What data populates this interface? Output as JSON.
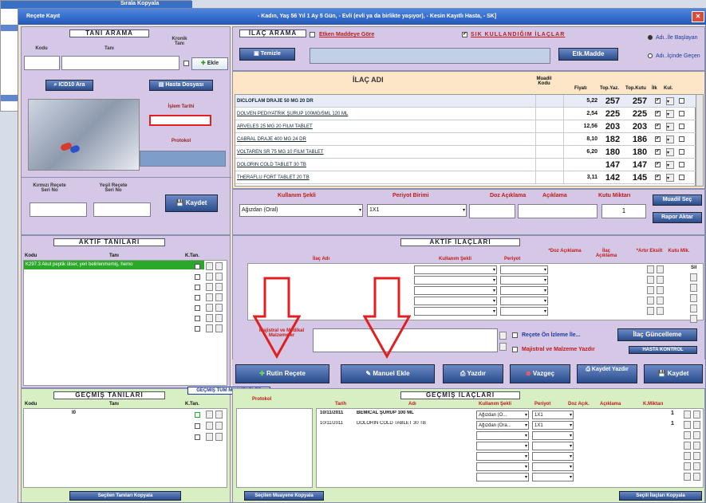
{
  "background_window": {
    "label": "Sırala Kopyala"
  },
  "window": {
    "title": "Reçete Kayıt",
    "patient_info": "- Kadın, Yaş 56 Yıl 1 Ay 5 Gün, - Evli (evli ya da birlikte yaşıyor), - Kesin Kayıtlı Hasta, - SK]"
  },
  "tani_arama": {
    "heading": "TANI ARAMA",
    "kodu_label": "Kodu",
    "tani_label": "Tanı",
    "kronik_label": "Kronik Tanı",
    "ekle_label": "Ekle",
    "icd10_label": "ICD10 Ara",
    "hasta_dosyasi_label": "Hasta Dosyası",
    "islem_tarihi_label": "İşlem Tarihi",
    "protokol_label": "Protokol"
  },
  "recete_seri": {
    "kirmizi_label": "Kırmızı Reçete Seri No",
    "yesil_label": "Yeşil Reçete Seri No",
    "kaydet_label": "Kaydet"
  },
  "ilac_arama": {
    "heading": "İLAÇ ARAMA",
    "etken_madde_label": "Etken Maddeye Göre",
    "sik_kullandigim_label": "SIK KULLANDIĞIM İLAÇLAR",
    "ad_ile_baslayan": "Adı..İle Başlayan",
    "ad_icinde_gecen": "Adı..İçinde Geçen",
    "temizle_label": "Temizle",
    "etk_madde_label": "Etk.Madde"
  },
  "ilac_table": {
    "headers": {
      "ilac_adi": "İLAÇ ADI",
      "muadil": "Muadil Kodu",
      "fiyat": "Fiyatı",
      "top_yaz": "Top.Yaz.",
      "top_kutu": "Top.Kutu",
      "ilk": "İlk",
      "kul": "Kul."
    },
    "rows": [
      {
        "name": "DICLOFLAM DRAJE 50 MG 20 DR",
        "price": "5,22",
        "top_yaz": "257",
        "top_kutu": "257"
      },
      {
        "name": "DOLVEN PEDIYATRIK ŞURUP 100MG/5ML 120 ML",
        "price": "2,54",
        "top_yaz": "225",
        "top_kutu": "225"
      },
      {
        "name": "ARVELES 25 MG 20 FILM TABLET",
        "price": "12,56",
        "top_yaz": "203",
        "top_kutu": "203"
      },
      {
        "name": "CABRAL DRAJE 400 MG 24 DR",
        "price": "8,10",
        "top_yaz": "182",
        "top_kutu": "186"
      },
      {
        "name": "VOLTAREN SR 75 MG 10 FILM TABLET",
        "price": "6,20",
        "top_yaz": "180",
        "top_kutu": "180"
      },
      {
        "name": "DOLORIN COLD TABLET 30 TB",
        "price": "",
        "top_yaz": "147",
        "top_kutu": "147"
      },
      {
        "name": "THERAFLU FORT TABLET 20 TB",
        "price": "3,11",
        "top_yaz": "142",
        "top_kutu": "145"
      }
    ]
  },
  "kullanim": {
    "kullanim_sekli_label": "Kullanım Şekli",
    "periyot_birimi_label": "Periyot Birimi",
    "doz_aciklama_label": "Doz Açıklama",
    "aciklama_label": "Açıklama",
    "kutu_miktari_label": "Kutu Miktarı",
    "kullanim_value": "Ağızdan (Oral)",
    "periyot_value": "1X1",
    "kutu_value": "1",
    "muadil_sec_label": "Muadil Seç",
    "rapor_aktar_label": "Rapor Aktar"
  },
  "aktif_tanilari": {
    "heading": "AKTİF TANILARI",
    "kodu_label": "Kodu",
    "tani_label": "Tanı",
    "ktan_label": "K.Tan.",
    "row_text": "K297.3  Akut peptik ülser, yeri belirlenmemiş, hemo"
  },
  "aktif_ilaclari": {
    "heading": "AKTİF İLAÇLARI",
    "ilac_adi_label": "İlaç Adı",
    "kullanim_sekli_label": "Kullanım Şekli",
    "periyot_label": "Periyot",
    "doz_aciklama_label": "*Doz Açıklama",
    "ilac_aciklama_label": "İlaç Açıklama",
    "artir_label": "*Artır Eksilt",
    "kutu_mik_label": "Kutu Mik.",
    "sil_label": "Sil"
  },
  "majistral": {
    "label": "Majistral ve Medikal Malzemeler",
    "recete_on_izleme": "Reçete Ön İzleme İle...",
    "majistral_yazdir": "Majistral ve Malzeme Yazdır",
    "ilac_guncelleme": "İlaç Güncelleme",
    "hasta_kontrol": "HASTA KONTROL"
  },
  "actions": {
    "rutin_recete": "Rutin Reçete",
    "manuel_ekle": "Manuel Ekle",
    "yazdir": "Yazdır",
    "vazgec": "Vazgeç",
    "kaydet_yazdir": "Kaydet Yazdır",
    "kaydet": "Kaydet"
  },
  "gecmis_tanilari": {
    "heading": "GEÇMİŞ TANILARI",
    "gecmis_tum_muayeneler": "GEÇMİŞ TÜM MUAYENELER",
    "kodu_label": "Kodu",
    "tani_label": "Tanı",
    "ktan_label": "K.Tan.",
    "row_code": "I0",
    "secilen_tanilari_kopyala": "Seçilen Tanıları Kopyala"
  },
  "gecmis_ilaclari": {
    "heading": "GEÇMİŞ İLAÇLARI",
    "protokol_label": "Protokol",
    "tarih_label": "Tarih",
    "adi_label": "Adı",
    "kullanim_label": "Kullanım Şekli",
    "periyot_label": "Periyot",
    "doz_label": "Doz Açık.",
    "aciklama_label": "Açıklama",
    "kmiktari_label": "K.Miktarı",
    "rows": [
      {
        "tarih": "10/11/2011",
        "adi": "BEMICAL ŞURUP 100 ML",
        "kullanim": "Ağızdan (O...",
        "periyot": "1X1",
        "miktar": "1"
      },
      {
        "tarih": "10/11/2011",
        "adi": "DOLORIN COLD TABLET 30 TB",
        "kullanim": "Ağızdan (Ora...",
        "periyot": "1X1",
        "miktar": "1"
      }
    ],
    "secilen_muayene_kopyala": "Seçilen Muayene Kopyala",
    "secili_ilaclari_kopyala": "Seçili İlaçları Kopyala"
  },
  "colors": {
    "accent_red": "#e02020",
    "header_blue": "#2458b8"
  }
}
